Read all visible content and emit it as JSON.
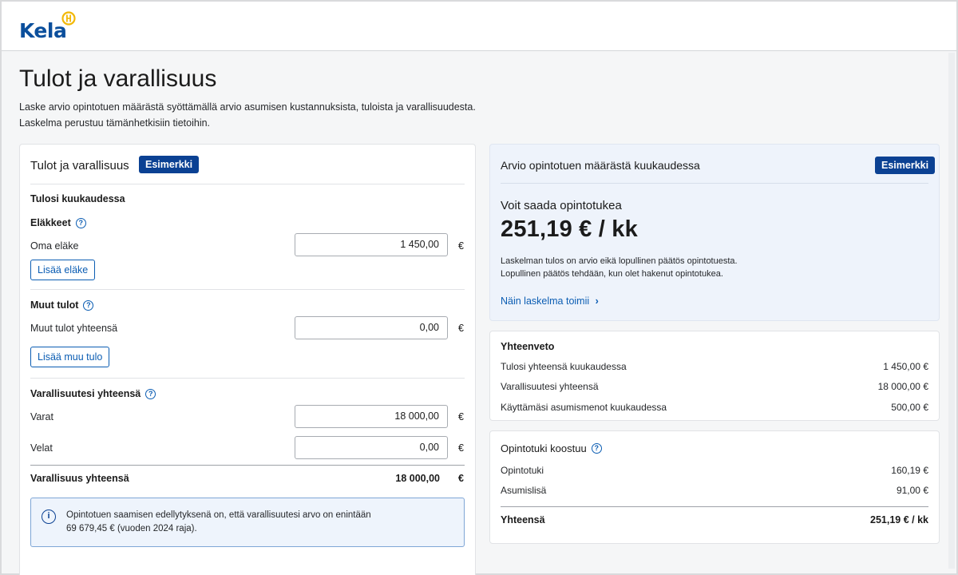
{
  "logo": {
    "text": "Kela"
  },
  "page": {
    "title": "Tulot ja varallisuus",
    "intro_line1": "Laske arvio opintotuen määrästä syöttämällä arvio asumisen kustannuksista, tuloista ja varallisuudesta.",
    "intro_line2": "Laskelma perustuu tämänhetkisiin tietoihin."
  },
  "form": {
    "title": "Tulot ja varallisuus",
    "badge": "Esimerkki",
    "section": "Tulosi kuukaudessa",
    "pensions": {
      "heading": "Eläkkeet",
      "help": "?",
      "field_label": "Oma eläke",
      "value": "1 450,00",
      "unit": "€",
      "add_button": "Lisää eläke"
    },
    "other_income": {
      "heading": "Muut tulot",
      "help": "?",
      "field_label": "Muut tulot yhteensä",
      "value": "0,00",
      "unit": "€",
      "add_button": "Lisää muu tulo"
    },
    "assets": {
      "heading": "Varallisuutesi yhteensä",
      "help": "?",
      "assets_label": "Varat",
      "assets_value": "18 000,00",
      "debts_label": "Velat",
      "debts_value": "0,00",
      "unit": "€",
      "total_label": "Varallisuus yhteensä",
      "total_value": "18 000,00"
    },
    "info": {
      "icon": "i",
      "line1": "Opintotuen saamisen edellytyksenä on, että varallisuutesi arvo on enintään",
      "line2": "69 679,45 € (vuoden 2024 raja)."
    }
  },
  "estimate": {
    "title": "Arvio opintotuen määrästä kuukaudessa",
    "badge": "Esimerkki",
    "subtitle": "Voit saada opintotukea",
    "amount": "251,19 € / kk",
    "note_line1": "Laskelman tulos on arvio eikä lopullinen päätös opintotuesta.",
    "note_line2": "Lopullinen päätös tehdään, kun olet hakenut opintotukea.",
    "link": "Näin laskelma toimii",
    "link_chevron": "›"
  },
  "summary": {
    "title": "Yhteenveto",
    "rows": [
      {
        "label": "Tulosi yhteensä kuukaudessa",
        "value": "1 450,00 €"
      },
      {
        "label": "Varallisuutesi yhteensä",
        "value": "18 000,00 €"
      },
      {
        "label": "Käyttämäsi asumismenot kuukaudessa",
        "value": "500,00 €"
      }
    ]
  },
  "composition": {
    "title": "Opintotuki koostuu",
    "help": "?",
    "rows": [
      {
        "label": "Opintotuki",
        "value": "160,19 €"
      },
      {
        "label": "Asumislisä",
        "value": "91,00 €"
      }
    ],
    "total_label": "Yhteensä",
    "total_value": "251,19 € / kk"
  },
  "colors": {
    "brand_blue": "#0b4193",
    "link_blue": "#0b5db3",
    "accent_yellow": "#f2b807"
  }
}
